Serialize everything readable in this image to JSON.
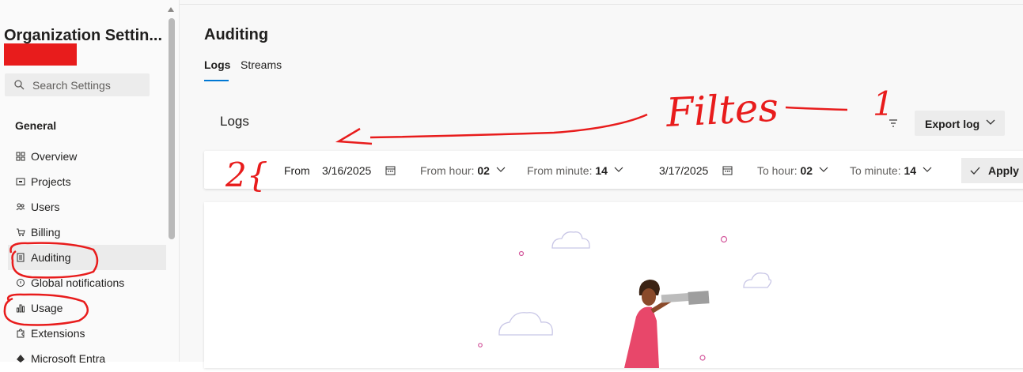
{
  "sidebar": {
    "org_title": "Organization Settin...",
    "search_placeholder": "Search Settings",
    "section_label": "General",
    "items": [
      {
        "label": "Overview",
        "icon": "grid-icon"
      },
      {
        "label": "Projects",
        "icon": "projects-icon"
      },
      {
        "label": "Users",
        "icon": "users-icon"
      },
      {
        "label": "Billing",
        "icon": "cart-icon"
      },
      {
        "label": "Auditing",
        "icon": "audit-icon",
        "active": true
      },
      {
        "label": "Global notifications",
        "icon": "notification-icon"
      },
      {
        "label": "Usage",
        "icon": "chart-icon"
      },
      {
        "label": "Extensions",
        "icon": "puzzle-icon"
      },
      {
        "label": "Microsoft Entra",
        "icon": "entra-icon"
      }
    ]
  },
  "main": {
    "title": "Auditing",
    "tabs": [
      {
        "label": "Logs",
        "active": true
      },
      {
        "label": "Streams",
        "active": false
      }
    ],
    "logs_heading": "Logs",
    "export_label": "Export log",
    "filters": {
      "from_label": "From",
      "from_date": "3/16/2025",
      "from_hour_label": "From hour:",
      "from_hour_value": "02",
      "from_minute_label": "From minute:",
      "from_minute_value": "14",
      "to_date": "3/17/2025",
      "to_hour_label": "To hour:",
      "to_hour_value": "02",
      "to_minute_label": "To minute:",
      "to_minute_value": "14",
      "apply_label": "Apply"
    }
  },
  "annotations": {
    "filters_text": "Filtes",
    "number_one": "1",
    "number_two": "2{"
  },
  "colors": {
    "accent": "#0078d4",
    "annotation_red": "#e81c1c",
    "redaction": "#e81c1c"
  }
}
